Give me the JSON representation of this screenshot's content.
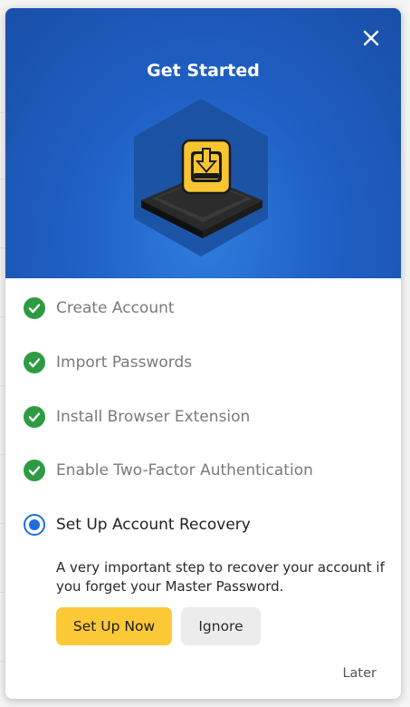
{
  "dialog": {
    "title": "Get Started",
    "close_icon": "close-icon"
  },
  "colors": {
    "hero_blue": "#1f60c4",
    "complete_green": "#2e9b43",
    "active_blue": "#1d6fdd",
    "primary_yellow": "#fcc936"
  },
  "steps": [
    {
      "label": "Create Account",
      "status": "complete"
    },
    {
      "label": "Import Passwords",
      "status": "complete"
    },
    {
      "label": "Install Browser Extension",
      "status": "complete"
    },
    {
      "label": "Enable Two-Factor Authentication",
      "status": "complete"
    },
    {
      "label": "Set Up Account Recovery",
      "status": "active"
    }
  ],
  "active_step": {
    "description": "A very important step to recover your account if you forget your Master Password.",
    "primary_button": "Set Up Now",
    "secondary_button": "Ignore"
  },
  "footer": {
    "later_label": "Later"
  }
}
